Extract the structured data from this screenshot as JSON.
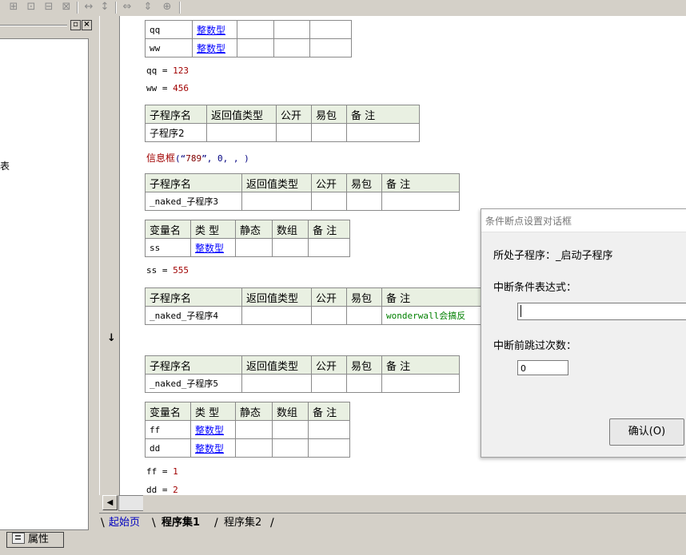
{
  "toolbar": {
    "icons": [
      "grid-icon",
      "table-icon",
      "table-alt-icon",
      "table-split-icon",
      "col-width-icon",
      "row-height-icon",
      "fit-width-icon",
      "fit-height-icon",
      "fit-all-icon"
    ]
  },
  "left_panel": {
    "snippet_text": "表",
    "properties_tab_label": "属性"
  },
  "editor": {
    "var_table_1": [
      {
        "name": "qq",
        "type": "整数型"
      },
      {
        "name": "ww",
        "type": "整数型"
      }
    ],
    "line_qq": {
      "var": "qq",
      "op": "=",
      "value": "123"
    },
    "line_ww": {
      "var": "ww",
      "op": "=",
      "value": "456"
    },
    "sub2_header": [
      "子程序名",
      "返回值类型",
      "公开",
      "易包",
      "备 注"
    ],
    "sub2_name": "子程序2",
    "msgbox_line": {
      "fn": "信息框",
      "open": "(“",
      "str": "789",
      "close_str": "”",
      "args": ", 0, , )"
    },
    "sub3_header": [
      "子程序名",
      "返回值类型",
      "公开",
      "易包",
      "备 注"
    ],
    "sub3_name": "_naked_子程序3",
    "vars3_header": [
      "变量名",
      "类 型",
      "静态",
      "数组",
      "备 注"
    ],
    "vars3_rows": [
      {
        "name": "ss",
        "type": "整数型"
      }
    ],
    "line_ss": {
      "var": "ss",
      "op": "=",
      "value": "555"
    },
    "sub4_header": [
      "子程序名",
      "返回值类型",
      "公开",
      "易包",
      "备 注"
    ],
    "sub4_name": "_naked_子程序4",
    "sub4_note": "wonderwall会搞反",
    "sub5_header": [
      "子程序名",
      "返回值类型",
      "公开",
      "易包",
      "备 注"
    ],
    "sub5_name": "_naked_子程序5",
    "vars5_header": [
      "变量名",
      "类 型",
      "静态",
      "数组",
      "备 注"
    ],
    "vars5_rows": [
      {
        "name": "ff",
        "type": "整数型"
      },
      {
        "name": "dd",
        "type": "整数型"
      }
    ],
    "line_ff": {
      "var": "ff",
      "op": "=",
      "value": "1"
    },
    "line_dd": {
      "var": "dd",
      "op": "=",
      "value": "2"
    }
  },
  "tabs": [
    {
      "label": "起始页"
    },
    {
      "label": "程序集1"
    },
    {
      "label": "程序集2"
    }
  ],
  "dialog": {
    "title": "条件断点设置对话框",
    "current_sub_label": "所处子程序：_启动子程序",
    "condition_label": "中断条件表达式：",
    "condition_value": "",
    "skip_label": "中断前跳过次数：",
    "skip_value": "0",
    "ok_button": "确认(O)"
  },
  "colors": {
    "header_bg": "#e9f0e2",
    "type_link": "#0000ff",
    "number": "#a00000",
    "note_green": "#008000"
  }
}
